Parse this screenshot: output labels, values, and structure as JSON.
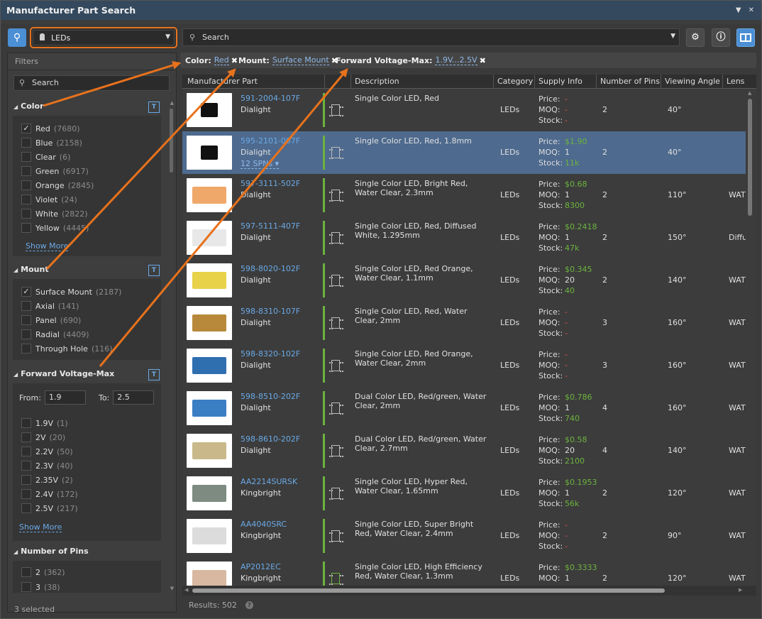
{
  "window": {
    "title": "Manufacturer Part Search"
  },
  "toolbar": {
    "category_value": "LEDs",
    "search_placeholder": "Search"
  },
  "filters": {
    "header": "Filters",
    "search_placeholder": "Search",
    "status": "3 selected",
    "show_more": "Show More",
    "color": {
      "title": "Color",
      "options": [
        {
          "label": "Red",
          "count": "(7680)",
          "checked": true
        },
        {
          "label": "Blue",
          "count": "(2158)",
          "checked": false
        },
        {
          "label": "Clear",
          "count": "(6)",
          "checked": false
        },
        {
          "label": "Green",
          "count": "(6917)",
          "checked": false
        },
        {
          "label": "Orange",
          "count": "(2845)",
          "checked": false
        },
        {
          "label": "Violet",
          "count": "(24)",
          "checked": false
        },
        {
          "label": "White",
          "count": "(2822)",
          "checked": false
        },
        {
          "label": "Yellow",
          "count": "(4445)",
          "checked": false
        }
      ]
    },
    "mount": {
      "title": "Mount",
      "options": [
        {
          "label": "Surface Mount",
          "count": "(2187)",
          "checked": true
        },
        {
          "label": "Axial",
          "count": "(141)",
          "checked": false
        },
        {
          "label": "Panel",
          "count": "(690)",
          "checked": false
        },
        {
          "label": "Radial",
          "count": "(4409)",
          "checked": false
        },
        {
          "label": "Through Hole",
          "count": "(116)",
          "checked": false
        }
      ]
    },
    "fv": {
      "title": "Forward Voltage-Max",
      "from_label": "From:",
      "from_value": "1.9",
      "to_label": "To:",
      "to_value": "2.5",
      "options": [
        {
          "label": "1.9V",
          "count": "(1)",
          "checked": false
        },
        {
          "label": "2V",
          "count": "(20)",
          "checked": false
        },
        {
          "label": "2.2V",
          "count": "(50)",
          "checked": false
        },
        {
          "label": "2.3V",
          "count": "(40)",
          "checked": false
        },
        {
          "label": "2.35V",
          "count": "(2)",
          "checked": false
        },
        {
          "label": "2.4V",
          "count": "(172)",
          "checked": false
        },
        {
          "label": "2.5V",
          "count": "(217)",
          "checked": false
        }
      ]
    },
    "pins": {
      "title": "Number of Pins",
      "options": [
        {
          "label": "2",
          "count": "(362)",
          "checked": false
        },
        {
          "label": "3",
          "count": "(38)",
          "checked": false
        }
      ]
    }
  },
  "chips": [
    {
      "label": "Color:",
      "value": "Red"
    },
    {
      "label": "Mount:",
      "value": "Surface Mount"
    },
    {
      "label": "Forward Voltage-Max:",
      "value": "1.9V...2.5V"
    }
  ],
  "table": {
    "columns": [
      "Manufacturer Part",
      "Description",
      "Category",
      "Supply Info",
      "Number of Pins",
      "Viewing Angle",
      "Lens"
    ],
    "supply_keys": [
      "Price:",
      "MOQ:",
      "Stock:"
    ],
    "rows": [
      {
        "mpn": "591-2004-107F",
        "mfr": "Dialight",
        "desc": "Single Color LED, Red",
        "cat": "LEDs",
        "price": "-",
        "moq": "-",
        "stock": "-",
        "pins": "2",
        "angle": "40°",
        "lens": "",
        "thumb": "#111"
      },
      {
        "mpn": "595-2101-007F",
        "mfr": "Dialight",
        "spn": "12 SPNs ▾",
        "desc": "Single Color LED, Red, 1.8mm",
        "cat": "LEDs",
        "price": "$1.90",
        "moq": "1",
        "stock": "11k",
        "pins": "2",
        "angle": "40°",
        "lens": "",
        "thumb": "#111",
        "selected": true
      },
      {
        "mpn": "597-3111-502F",
        "mfr": "Dialight",
        "desc": "Single Color LED, Bright Red, Water Clear, 2.3mm",
        "cat": "LEDs",
        "price": "$0.68",
        "moq": "1",
        "stock": "8300",
        "pins": "2",
        "angle": "110°",
        "lens": "WAT",
        "thumb": "#f0a86a"
      },
      {
        "mpn": "597-5111-407F",
        "mfr": "Dialight",
        "desc": "Single Color LED, Red, Diffused White, 1.295mm",
        "cat": "LEDs",
        "price": "$0.2418",
        "moq": "1",
        "stock": "47k",
        "pins": "2",
        "angle": "150°",
        "lens": "Diffu",
        "thumb": "#e8e8e8"
      },
      {
        "mpn": "598-8020-102F",
        "mfr": "Dialight",
        "desc": "Single Color LED, Red Orange, Water Clear, 1.1mm",
        "cat": "LEDs",
        "price": "$0.345",
        "moq": "20",
        "stock": "40",
        "pins": "2",
        "angle": "140°",
        "lens": "WAT",
        "thumb": "#e8d24a"
      },
      {
        "mpn": "598-8310-107F",
        "mfr": "Dialight",
        "desc": "Single Color LED, Red, Water Clear, 2mm",
        "cat": "LEDs",
        "price": "-",
        "moq": "-",
        "stock": "-",
        "pins": "3",
        "angle": "160°",
        "lens": "WAT",
        "thumb": "#b8893a"
      },
      {
        "mpn": "598-8320-102F",
        "mfr": "Dialight",
        "desc": "Single Color LED, Red Orange, Water Clear, 2mm",
        "cat": "LEDs",
        "price": "-",
        "moq": "-",
        "stock": "-",
        "pins": "3",
        "angle": "160°",
        "lens": "WAT",
        "thumb": "#2f6fb0"
      },
      {
        "mpn": "598-8510-202F",
        "mfr": "Dialight",
        "desc": "Dual Color LED, Red/green, Water Clear, 2mm",
        "cat": "LEDs",
        "price": "$0.786",
        "moq": "1",
        "stock": "740",
        "pins": "4",
        "angle": "160°",
        "lens": "WAT",
        "thumb": "#3a7ec4"
      },
      {
        "mpn": "598-8610-202F",
        "mfr": "Dialight",
        "desc": "Dual Color LED, Red/green, Water Clear, 2.7mm",
        "cat": "LEDs",
        "price": "$0.58",
        "moq": "20",
        "stock": "2100",
        "pins": "4",
        "angle": "140°",
        "lens": "WAT",
        "thumb": "#c9b98a"
      },
      {
        "mpn": "AA2214SURSK",
        "mfr": "Kingbright",
        "desc": "Single Color LED, Hyper Red, Water Clear, 1.65mm",
        "cat": "LEDs",
        "price": "$0.1953",
        "moq": "1",
        "stock": "56k",
        "pins": "2",
        "angle": "120°",
        "lens": "WAT",
        "thumb": "#7d8b80"
      },
      {
        "mpn": "AA4040SRC",
        "mfr": "Kingbright",
        "desc": "Single Color LED, Super Bright Red, Water Clear, 2.4mm",
        "cat": "LEDs",
        "price": "-",
        "moq": "-",
        "stock": "-",
        "pins": "2",
        "angle": "90°",
        "lens": "WAT",
        "thumb": "#dcdcdc"
      },
      {
        "mpn": "AP2012EC",
        "mfr": "Kingbright",
        "desc": "Single Color LED, High Efficiency Red, Water Clear, 1.3mm",
        "cat": "LEDs",
        "price": "$0.3333",
        "moq": "1",
        "stock": "",
        "pins": "2",
        "angle": "120°",
        "lens": "WAT",
        "thumb": "#d8b8a0",
        "green_icon": true
      }
    ]
  },
  "status": {
    "results": "Results: 502",
    "help": "?"
  },
  "colors": {
    "accent": "#4b8fd4",
    "highlight": "#e8721c",
    "price_green": "#6cb33e",
    "dash_red": "#e04e4e",
    "selected_row": "#4e6a8e"
  }
}
